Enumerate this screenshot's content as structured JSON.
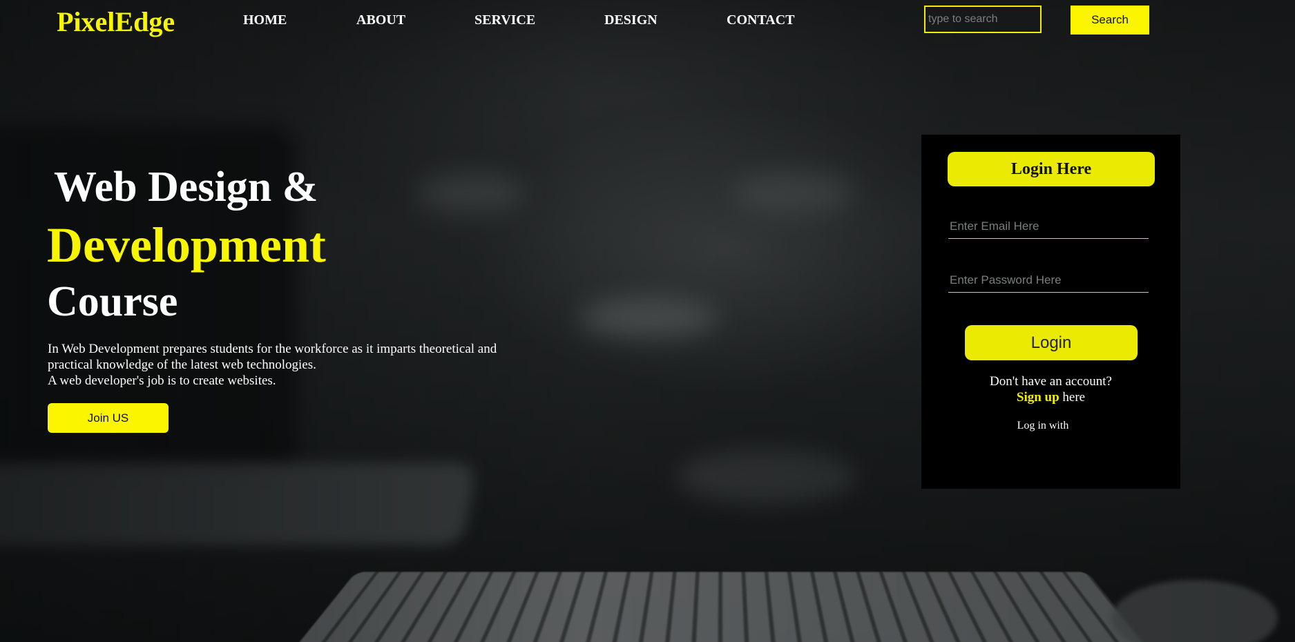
{
  "header": {
    "logo": "PixelEdge",
    "nav": [
      "HOME",
      "ABOUT",
      "SERVICE",
      "DESIGN",
      "CONTACT"
    ],
    "search": {
      "placeholder": "type to search",
      "value": "",
      "button_label": "Search"
    }
  },
  "hero": {
    "line1": "Web Design &",
    "line2": "Development",
    "line3": "Course",
    "paragraph_line1": "In Web Development prepares students for the workforce as it imparts theoretical and",
    "paragraph_line2": "practical knowledge of the latest web technologies.",
    "paragraph_line3": "A web developer's job is to create websites.",
    "join_label": "Join US"
  },
  "login": {
    "title": "Login Here",
    "email_placeholder": "Enter Email Here",
    "password_placeholder": "Enter Password Here",
    "login_label": "Login",
    "no_account": "Don't have an account?",
    "signup_link": "Sign up",
    "signup_suffix": "here",
    "login_with": "Log in with"
  },
  "colors": {
    "accent": "#f8f500",
    "panel_bg": "#000000",
    "text": "#ffffff"
  }
}
